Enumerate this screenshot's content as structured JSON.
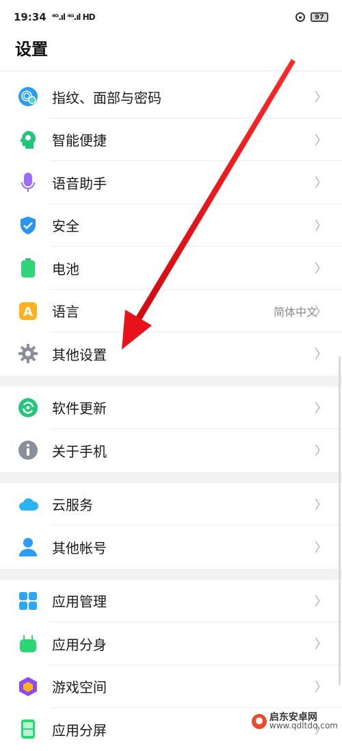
{
  "status": {
    "time": "19:34",
    "signal": "⁴ᴳ.ıl ⁴ᴳ.ıl HD",
    "battery": "97"
  },
  "title": "设置",
  "groups": [
    [
      {
        "label": "指纹、面部与密码",
        "icon": "fingerprint-face-icon"
      },
      {
        "label": "智能便捷",
        "icon": "smart-head-icon"
      },
      {
        "label": "语音助手",
        "icon": "microphone-icon"
      },
      {
        "label": "安全",
        "icon": "shield-icon"
      },
      {
        "label": "电池",
        "icon": "battery-icon"
      },
      {
        "label": "语言",
        "icon": "language-icon",
        "value": "简体中文"
      },
      {
        "label": "其他设置",
        "icon": "gear-icon"
      }
    ],
    [
      {
        "label": "软件更新",
        "icon": "refresh-icon"
      },
      {
        "label": "关于手机",
        "icon": "info-icon"
      }
    ],
    [
      {
        "label": "云服务",
        "icon": "cloud-icon"
      },
      {
        "label": "其他帐号",
        "icon": "person-icon"
      }
    ],
    [
      {
        "label": "应用管理",
        "icon": "app-grid-icon"
      },
      {
        "label": "应用分身",
        "icon": "android-icon"
      },
      {
        "label": "游戏空间",
        "icon": "game-cube-icon"
      },
      {
        "label": "应用分屏",
        "icon": "split-screen-icon"
      }
    ]
  ],
  "chevron": "〉",
  "watermark": {
    "cn": "启东安卓网",
    "url": "www.qdltdq.com"
  },
  "colors": {
    "annotation_arrow": "#e8131a"
  }
}
